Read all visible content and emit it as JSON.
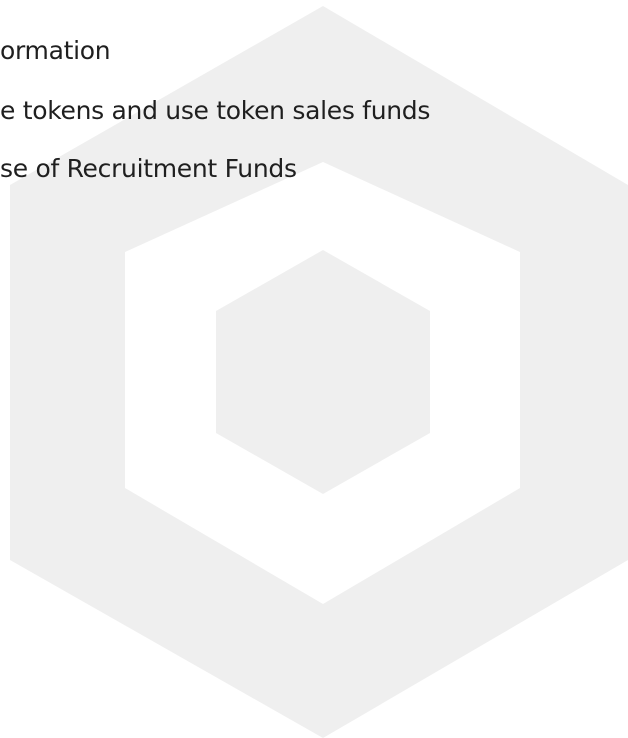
{
  "document": {
    "lines": [
      "ormation",
      "e tokens and use token sales funds",
      "se of Recruitment Funds"
    ]
  },
  "watermark": {
    "icon": "hexagon-logo-icon",
    "color": "#efefef"
  }
}
